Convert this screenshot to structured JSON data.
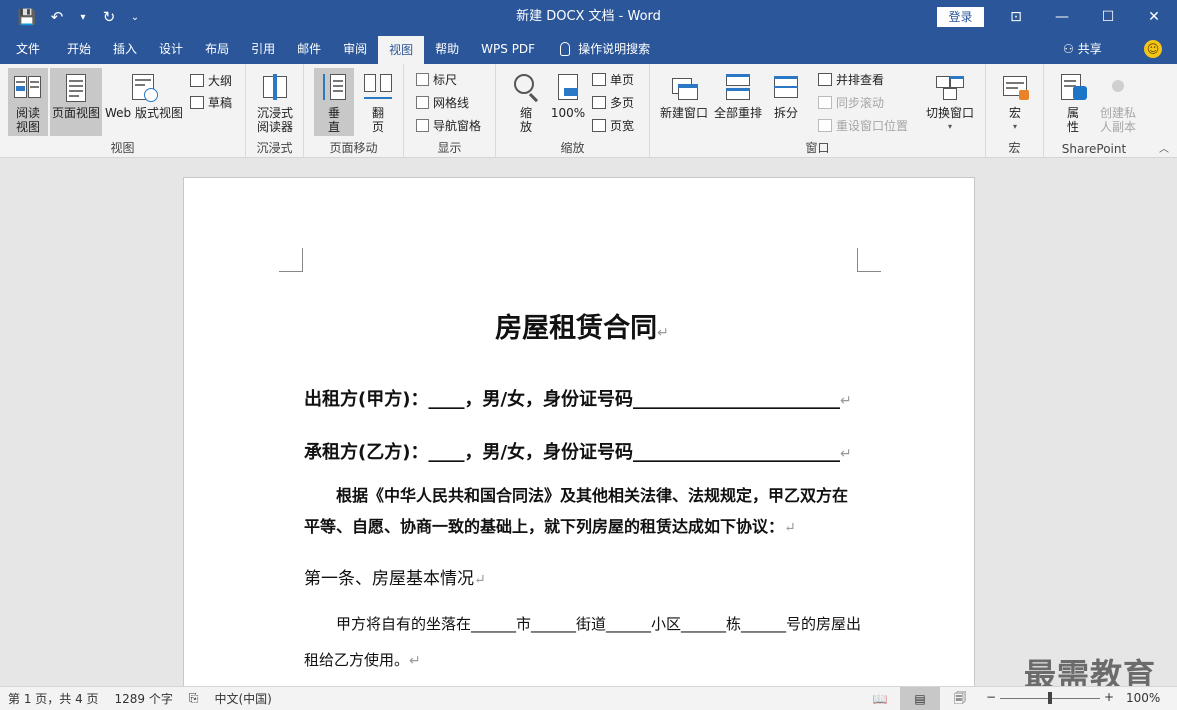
{
  "titlebar": {
    "title": "新建 DOCX 文档  -  Word",
    "login": "登录",
    "qat": {
      "save": "💾",
      "undo": "↶",
      "undo_dd": "▾",
      "redo": "↻",
      "customize": "⌄"
    },
    "win": {
      "ribbon_opts": "⊡",
      "minimize": "—",
      "restore": "☐",
      "close": "✕"
    }
  },
  "tabs": {
    "items": [
      "文件",
      "开始",
      "插入",
      "设计",
      "布局",
      "引用",
      "邮件",
      "审阅",
      "视图",
      "帮助",
      "WPS PDF"
    ],
    "active": "视图",
    "search": "操作说明搜索",
    "share": "共享",
    "share_icon": "⚇",
    "smiley": "☺"
  },
  "ribbon": {
    "views": {
      "label": "视图",
      "read_mode": "阅读\n视图",
      "print_layout": "页面视图",
      "web_layout": "Web 版式视图",
      "outline": "大纲",
      "draft": "草稿"
    },
    "immersive": {
      "label": "沉浸式",
      "reader": "沉浸式\n阅读器"
    },
    "page_move": {
      "label": "页面移动",
      "vertical": "垂\n直",
      "flip": "翻\n页"
    },
    "show": {
      "label": "显示",
      "ruler": "标尺",
      "gridlines": "网格线",
      "nav_pane": "导航窗格"
    },
    "zoom": {
      "label": "缩放",
      "zoom": "缩\n放",
      "hundred": "100%",
      "one_page": "单页",
      "multi_page": "多页",
      "page_width": "页宽"
    },
    "window": {
      "label": "窗口",
      "new_window": "新建窗口",
      "arrange_all": "全部重排",
      "split": "拆分",
      "side_by_side": "并排查看",
      "sync_scroll": "同步滚动",
      "reset_pos": "重设窗口位置",
      "switch": "切换窗口"
    },
    "macros": {
      "label": "宏",
      "macros": "宏"
    },
    "sharepoint": {
      "label": "SharePoint",
      "properties": "属\n性",
      "create_copy": "创建私\n人副本"
    },
    "collapse": "︿"
  },
  "document": {
    "title": "房屋租赁合同",
    "para_mark": "↵",
    "line1": "出租方(甲方)：____，男/女，身份证号码_______________________",
    "line2": "承租方(乙方)：____，男/女，身份证号码_______________________",
    "para3": "根据《中华人民共和国合同法》及其他相关法律、法规规定，甲乙双方在平等、自愿、协商一致的基础上，就下列房屋的租赁达成如下协议：",
    "heading1": "第一条、房屋基本情况",
    "para5": "甲方将自有的坐落在______市______街道______小区______栋______号的房屋出租给乙方使用。"
  },
  "watermark": "最需教育",
  "status": {
    "pages": "第 1 页，共 4 页",
    "words": "1289 个字",
    "proof_icon": "⎘",
    "language": "中文(中国)",
    "zoom_out": "−",
    "zoom_in": "+",
    "zoom": "100%",
    "view_icons": {
      "read": "📖",
      "print": "▤",
      "web": "🗐"
    }
  }
}
